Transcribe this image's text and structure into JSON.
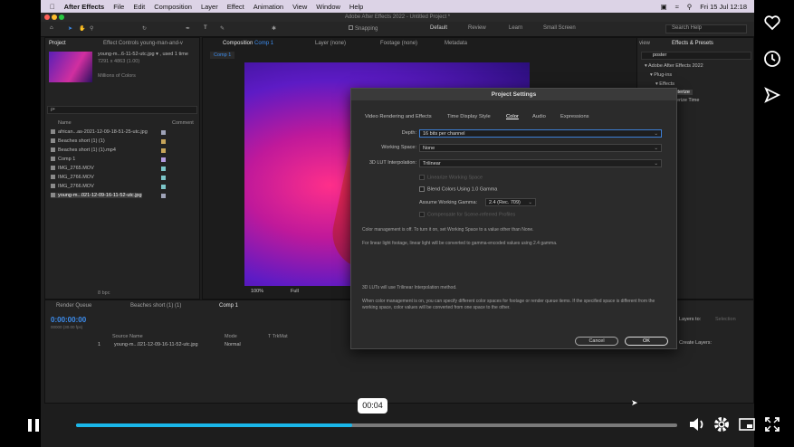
{
  "mac_menu": {
    "apple": "",
    "app_name": "After Effects",
    "items": [
      "File",
      "Edit",
      "Composition",
      "Layer",
      "Effect",
      "Animation",
      "View",
      "Window",
      "Help"
    ],
    "clock": "Fri 15 Jul  12:18"
  },
  "window_title": "Adobe After Effects 2022 - Untitled Project *",
  "toolbar": {
    "snapping": "Snapping",
    "workspaces": [
      "Default",
      "Review",
      "Learn",
      "Small Screen"
    ],
    "search_placeholder": "Search Help"
  },
  "project_panel": {
    "tab": "Project",
    "tab2": "Effect Controls young-man-and-v",
    "selected_name": "young-m...6-11-52-utc.jpg ▾ , used 1 time",
    "selected_dims": "7291 x 4863 (1.00)",
    "selected_colors": "Millions of Colors",
    "search_placeholder": "ρ•",
    "col_name": "Name",
    "col_comment": "Comment",
    "items": [
      {
        "name": "african...as-2021-12-09-18-51-25-utc.jpg",
        "color": "#9fa3b8"
      },
      {
        "name": "Beaches short (1) (1)",
        "color": "#c7a55a"
      },
      {
        "name": "Beaches short (1) (1).mp4",
        "color": "#c7a55a"
      },
      {
        "name": "Comp 1",
        "color": "#b39be0"
      },
      {
        "name": "IMG_2765.MOV",
        "color": "#7bc5c8"
      },
      {
        "name": "IMG_2766.MOV",
        "color": "#7bc5c8"
      },
      {
        "name": "IMG_2766.MOV",
        "color": "#7bc5c8"
      },
      {
        "name": "young-m...021-12-09-16-11-52-utc.jpg",
        "color": "#9fa3b8"
      }
    ],
    "bpc": "8 bpc"
  },
  "comp_panel": {
    "tab_label": "Composition",
    "comp_name": "Comp 1",
    "layer_tab": "Layer (none)",
    "footage_tab": "Footage (none)",
    "metadata_tab": "Metadata",
    "comp_chip": "Comp 1",
    "zoom": "100%",
    "resolution": "Full"
  },
  "effects_panel": {
    "tab_view": "view",
    "tab": "Effects & Presets",
    "search_value": "poster",
    "tree": [
      "▾ Adobe After Effects 2022",
      "▾ Plug-ins",
      "▾ Effects",
      "Posterize",
      "Posterize Time"
    ]
  },
  "timeline": {
    "tabs": [
      "Render Queue",
      "Beaches short (1) (1)",
      "Comp 1"
    ],
    "timecode": "0:00:00:00",
    "fps": "00000 (30.00 fps)",
    "cols": {
      "source": "Source Name",
      "mode": "Mode",
      "trkmat": "T TrkMat"
    },
    "layer_num": "1",
    "layer_name": "young-m...021-12-09-16-11-52-utc.jpg",
    "layer_mode": "Normal",
    "right_labels": [
      "Layers to:",
      "Selection",
      "Create Layers:"
    ]
  },
  "dialog": {
    "title": "Project Settings",
    "tabs": [
      "Video Rendering and Effects",
      "Time Display Style",
      "Color",
      "Audio",
      "Expressions"
    ],
    "active_tab": "Color",
    "depth_label": "Depth:",
    "depth_value": "16 bits per channel",
    "workspace_label": "Working Space:",
    "workspace_value": "None",
    "lut_label": "3D LUT Interpolation:",
    "lut_value": "Trilinear",
    "cb_linearize": "Linearize Working Space",
    "cb_blend": "Blend Colors Using 1.0 Gamma",
    "gamma_label": "Assume Working Gamma:",
    "gamma_value": "2.4 (Rec. 709)",
    "cb_compensate": "Compensate for Scene-referred Profiles",
    "note1": "Color management is off. To turn it on, set Working Space to a value other than None.",
    "note2": "For linear light footage, linear light will be converted to gamma-encoded values using 2.4 gamma.",
    "note3": "3D LUTs will use Trilinear Interpolation method.",
    "note4": "When color management is on, you can specify different color spaces for footage or render queue items. If the specified space is different from the working space, color values will be converted from one space to the other.",
    "cancel": "Cancel",
    "ok": "OK"
  },
  "video_player": {
    "time_tooltip": "00:04",
    "progress": 0.46,
    "accent": "#1ab7ea"
  }
}
